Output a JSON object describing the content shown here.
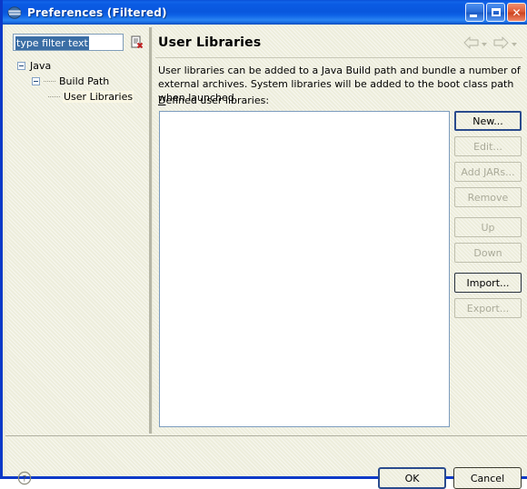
{
  "window": {
    "title": "Preferences (Filtered)",
    "app_icon": "eclipse-icon",
    "buttons": {
      "minimize": "minimize-button",
      "maximize": "maximize-button",
      "close": "close-button",
      "close_glyph": "✕"
    },
    "colors": {
      "titlebar_blue": "#0957DD",
      "border_blue": "#0B39C8",
      "dialog_bg": "#EDEDDC",
      "selection_blue": "#3B6EA5",
      "tree_selection": "#FAF7E4",
      "close_red": "#CC4420",
      "focus_border": "#2A4B8D"
    }
  },
  "sidebar": {
    "filter": {
      "value": "type filter text",
      "placeholder": "type filter text",
      "selected": true
    },
    "clear_filter_icon": "clear-filter-icon",
    "tree": [
      {
        "label": "Java",
        "level": 0,
        "expanded": true,
        "selected": false
      },
      {
        "label": "Build Path",
        "level": 1,
        "expanded": true,
        "selected": false
      },
      {
        "label": "User Libraries",
        "level": 2,
        "expanded": false,
        "selected": true
      }
    ]
  },
  "content": {
    "title": "User Libraries",
    "nav": {
      "back_icon": "arrow-left-icon",
      "back_dropdown_icon": "chevron-down-icon",
      "forward_icon": "arrow-right-icon",
      "forward_dropdown_icon": "chevron-down-icon"
    },
    "description": "User libraries can be added to a Java Build path and bundle a number of external archives. System libraries will be added to the boot class path when launched.",
    "list_label": "Defined user libraries:",
    "list_label_mnemonic": "D",
    "list_items": [],
    "buttons": [
      {
        "label": "New...",
        "mnemonic": "e",
        "enabled": true,
        "focused": true,
        "name": "new-button"
      },
      {
        "label": "Edit...",
        "mnemonic": "d",
        "enabled": false,
        "focused": false,
        "name": "edit-button"
      },
      {
        "label": "Add JARs...",
        "mnemonic": "J",
        "enabled": false,
        "focused": false,
        "name": "add-jars-button"
      },
      {
        "label": "Remove",
        "mnemonic": "R",
        "enabled": false,
        "focused": false,
        "name": "remove-button"
      },
      {
        "label": "Up",
        "mnemonic": "U",
        "enabled": false,
        "focused": false,
        "name": "up-button",
        "group_gap": true
      },
      {
        "label": "Down",
        "mnemonic": "o",
        "enabled": false,
        "focused": false,
        "name": "down-button"
      },
      {
        "label": "Import...",
        "mnemonic": "m",
        "enabled": true,
        "focused": false,
        "name": "import-button",
        "group_gap": true
      },
      {
        "label": "Export...",
        "mnemonic": "E",
        "enabled": false,
        "focused": false,
        "name": "export-button"
      }
    ]
  },
  "footer": {
    "help_icon": "help-question-icon",
    "ok_label": "OK",
    "cancel_label": "Cancel",
    "default_button": "OK"
  }
}
